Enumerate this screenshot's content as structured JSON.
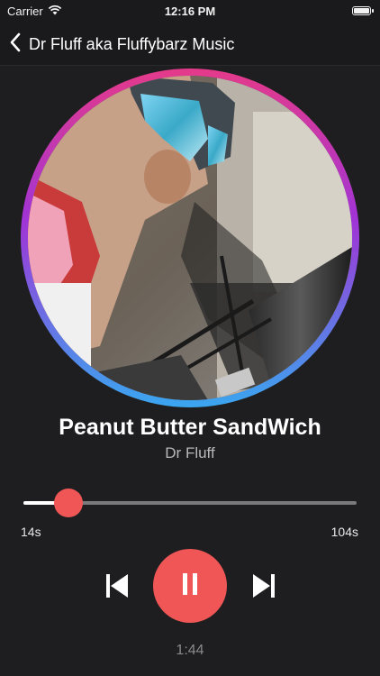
{
  "status_bar": {
    "carrier": "Carrier",
    "time": "12:16 PM"
  },
  "nav": {
    "title": "Dr Fluff aka Fluffybarz Music",
    "back_icon": "chevron-left-icon"
  },
  "track": {
    "title": "Peanut Butter SandWich",
    "artist": "Dr Fluff"
  },
  "progress": {
    "elapsed_label": "14s",
    "duration_label": "104s",
    "fraction": 0.1346,
    "remaining_label": "1:44"
  },
  "controls": {
    "previous_icon": "skip-back-icon",
    "play_pause_icon": "pause-icon",
    "next_icon": "skip-forward-icon"
  },
  "colors": {
    "accent": "#f05656",
    "ring_top": "#e53a8a",
    "ring_mid": "#a034d6",
    "ring_bottom": "#3aa6f0",
    "background": "#1e1e20"
  }
}
